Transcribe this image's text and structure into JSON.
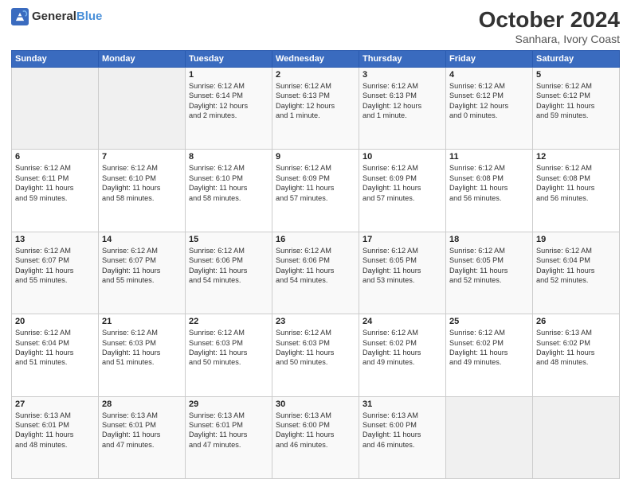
{
  "header": {
    "logo_general": "General",
    "logo_blue": "Blue",
    "month": "October 2024",
    "location": "Sanhara, Ivory Coast"
  },
  "weekdays": [
    "Sunday",
    "Monday",
    "Tuesday",
    "Wednesday",
    "Thursday",
    "Friday",
    "Saturday"
  ],
  "weeks": [
    [
      {
        "day": "",
        "info": ""
      },
      {
        "day": "",
        "info": ""
      },
      {
        "day": "1",
        "info": "Sunrise: 6:12 AM\nSunset: 6:14 PM\nDaylight: 12 hours\nand 2 minutes."
      },
      {
        "day": "2",
        "info": "Sunrise: 6:12 AM\nSunset: 6:13 PM\nDaylight: 12 hours\nand 1 minute."
      },
      {
        "day": "3",
        "info": "Sunrise: 6:12 AM\nSunset: 6:13 PM\nDaylight: 12 hours\nand 1 minute."
      },
      {
        "day": "4",
        "info": "Sunrise: 6:12 AM\nSunset: 6:12 PM\nDaylight: 12 hours\nand 0 minutes."
      },
      {
        "day": "5",
        "info": "Sunrise: 6:12 AM\nSunset: 6:12 PM\nDaylight: 11 hours\nand 59 minutes."
      }
    ],
    [
      {
        "day": "6",
        "info": "Sunrise: 6:12 AM\nSunset: 6:11 PM\nDaylight: 11 hours\nand 59 minutes."
      },
      {
        "day": "7",
        "info": "Sunrise: 6:12 AM\nSunset: 6:10 PM\nDaylight: 11 hours\nand 58 minutes."
      },
      {
        "day": "8",
        "info": "Sunrise: 6:12 AM\nSunset: 6:10 PM\nDaylight: 11 hours\nand 58 minutes."
      },
      {
        "day": "9",
        "info": "Sunrise: 6:12 AM\nSunset: 6:09 PM\nDaylight: 11 hours\nand 57 minutes."
      },
      {
        "day": "10",
        "info": "Sunrise: 6:12 AM\nSunset: 6:09 PM\nDaylight: 11 hours\nand 57 minutes."
      },
      {
        "day": "11",
        "info": "Sunrise: 6:12 AM\nSunset: 6:08 PM\nDaylight: 11 hours\nand 56 minutes."
      },
      {
        "day": "12",
        "info": "Sunrise: 6:12 AM\nSunset: 6:08 PM\nDaylight: 11 hours\nand 56 minutes."
      }
    ],
    [
      {
        "day": "13",
        "info": "Sunrise: 6:12 AM\nSunset: 6:07 PM\nDaylight: 11 hours\nand 55 minutes."
      },
      {
        "day": "14",
        "info": "Sunrise: 6:12 AM\nSunset: 6:07 PM\nDaylight: 11 hours\nand 55 minutes."
      },
      {
        "day": "15",
        "info": "Sunrise: 6:12 AM\nSunset: 6:06 PM\nDaylight: 11 hours\nand 54 minutes."
      },
      {
        "day": "16",
        "info": "Sunrise: 6:12 AM\nSunset: 6:06 PM\nDaylight: 11 hours\nand 54 minutes."
      },
      {
        "day": "17",
        "info": "Sunrise: 6:12 AM\nSunset: 6:05 PM\nDaylight: 11 hours\nand 53 minutes."
      },
      {
        "day": "18",
        "info": "Sunrise: 6:12 AM\nSunset: 6:05 PM\nDaylight: 11 hours\nand 52 minutes."
      },
      {
        "day": "19",
        "info": "Sunrise: 6:12 AM\nSunset: 6:04 PM\nDaylight: 11 hours\nand 52 minutes."
      }
    ],
    [
      {
        "day": "20",
        "info": "Sunrise: 6:12 AM\nSunset: 6:04 PM\nDaylight: 11 hours\nand 51 minutes."
      },
      {
        "day": "21",
        "info": "Sunrise: 6:12 AM\nSunset: 6:03 PM\nDaylight: 11 hours\nand 51 minutes."
      },
      {
        "day": "22",
        "info": "Sunrise: 6:12 AM\nSunset: 6:03 PM\nDaylight: 11 hours\nand 50 minutes."
      },
      {
        "day": "23",
        "info": "Sunrise: 6:12 AM\nSunset: 6:03 PM\nDaylight: 11 hours\nand 50 minutes."
      },
      {
        "day": "24",
        "info": "Sunrise: 6:12 AM\nSunset: 6:02 PM\nDaylight: 11 hours\nand 49 minutes."
      },
      {
        "day": "25",
        "info": "Sunrise: 6:12 AM\nSunset: 6:02 PM\nDaylight: 11 hours\nand 49 minutes."
      },
      {
        "day": "26",
        "info": "Sunrise: 6:13 AM\nSunset: 6:02 PM\nDaylight: 11 hours\nand 48 minutes."
      }
    ],
    [
      {
        "day": "27",
        "info": "Sunrise: 6:13 AM\nSunset: 6:01 PM\nDaylight: 11 hours\nand 48 minutes."
      },
      {
        "day": "28",
        "info": "Sunrise: 6:13 AM\nSunset: 6:01 PM\nDaylight: 11 hours\nand 47 minutes."
      },
      {
        "day": "29",
        "info": "Sunrise: 6:13 AM\nSunset: 6:01 PM\nDaylight: 11 hours\nand 47 minutes."
      },
      {
        "day": "30",
        "info": "Sunrise: 6:13 AM\nSunset: 6:00 PM\nDaylight: 11 hours\nand 46 minutes."
      },
      {
        "day": "31",
        "info": "Sunrise: 6:13 AM\nSunset: 6:00 PM\nDaylight: 11 hours\nand 46 minutes."
      },
      {
        "day": "",
        "info": ""
      },
      {
        "day": "",
        "info": ""
      }
    ]
  ]
}
